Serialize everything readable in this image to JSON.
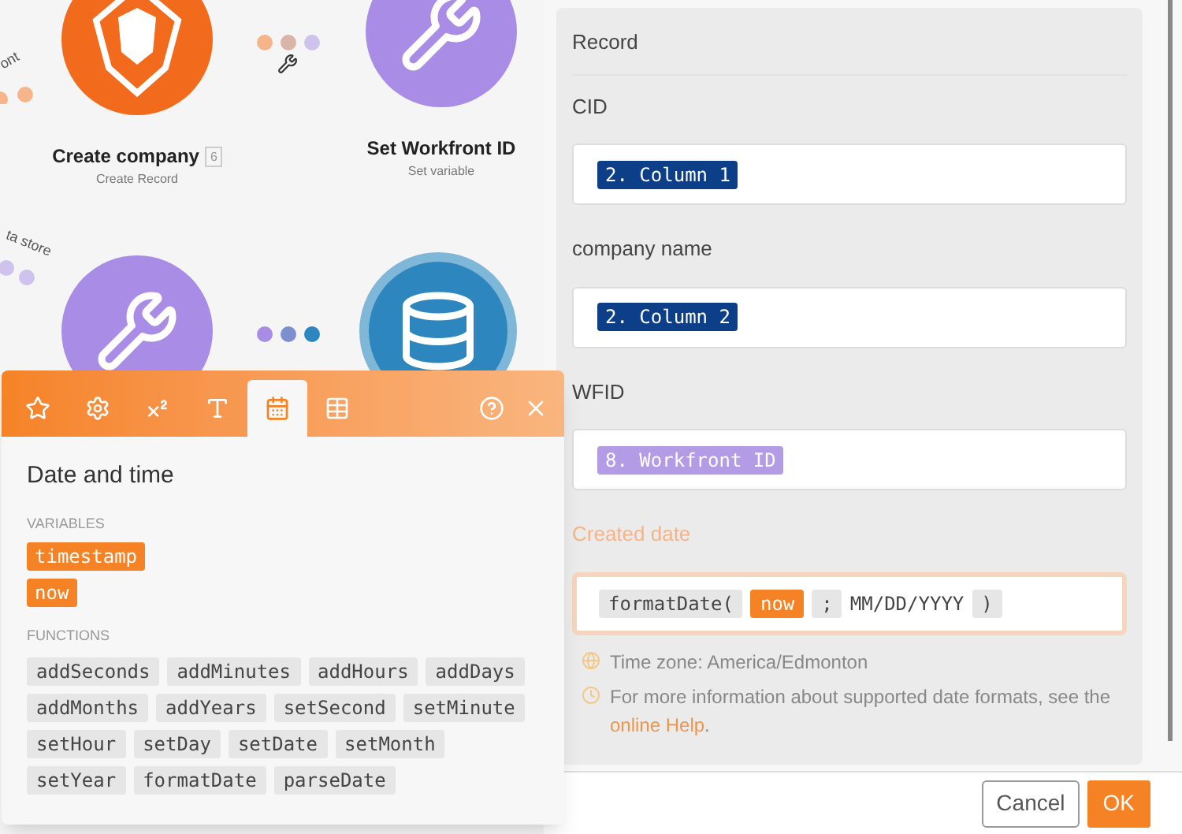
{
  "canvas": {
    "nodes": [
      {
        "kind": "app",
        "title": "Create company",
        "badge": "6",
        "subtitle": "Create Record"
      },
      {
        "kind": "tools",
        "title": "Set Workfront ID",
        "subtitle": "Set variable"
      },
      {
        "kind": "tools"
      },
      {
        "kind": "database"
      }
    ],
    "connector_labels": [
      "ont",
      "ta store"
    ]
  },
  "popup": {
    "tabs": [
      {
        "kind": "star",
        "selected": false
      },
      {
        "kind": "gear",
        "selected": false
      },
      {
        "kind": "superscript",
        "selected": false
      },
      {
        "kind": "text",
        "selected": false
      },
      {
        "kind": "calendar",
        "selected": true
      },
      {
        "kind": "table",
        "selected": false
      }
    ],
    "title": "Date and time",
    "variables_label": "VARIABLES",
    "variables": [
      "timestamp",
      "now"
    ],
    "functions_label": "FUNCTIONS",
    "functions": [
      "addSeconds",
      "addMinutes",
      "addHours",
      "addDays",
      "addMonths",
      "addYears",
      "setSecond",
      "setMinute",
      "setHour",
      "setDay",
      "setDate",
      "setMonth",
      "setYear",
      "formatDate",
      "parseDate"
    ]
  },
  "form": {
    "section": "Record",
    "fields": [
      {
        "label": "CID",
        "token": {
          "text": "2. Column 1",
          "color": "#0d3f88"
        }
      },
      {
        "label": "company name",
        "token": {
          "text": "2. Column 2",
          "color": "#0d3f88"
        }
      },
      {
        "label": "WFID",
        "token": {
          "text": "8. Workfront ID",
          "color": "#b49be6"
        }
      }
    ],
    "active_field": {
      "label": "Created date",
      "tokens": [
        {
          "kind": "function",
          "text": "formatDate("
        },
        {
          "kind": "variable",
          "text": "now"
        },
        {
          "kind": "function",
          "text": ";"
        },
        {
          "kind": "plain",
          "text": "MM/DD/YYYY"
        },
        {
          "kind": "function",
          "text": ")"
        }
      ]
    },
    "hints": [
      {
        "kind": "globe",
        "text": "Time zone: America/Edmonton"
      },
      {
        "kind": "clock",
        "text": "For more information about supported date formats, see the ",
        "link": "online Help",
        "after": "."
      }
    ],
    "buttons": [
      {
        "kind": "secondary",
        "label": "Cancel"
      },
      {
        "kind": "primary",
        "label": "OK"
      }
    ]
  }
}
